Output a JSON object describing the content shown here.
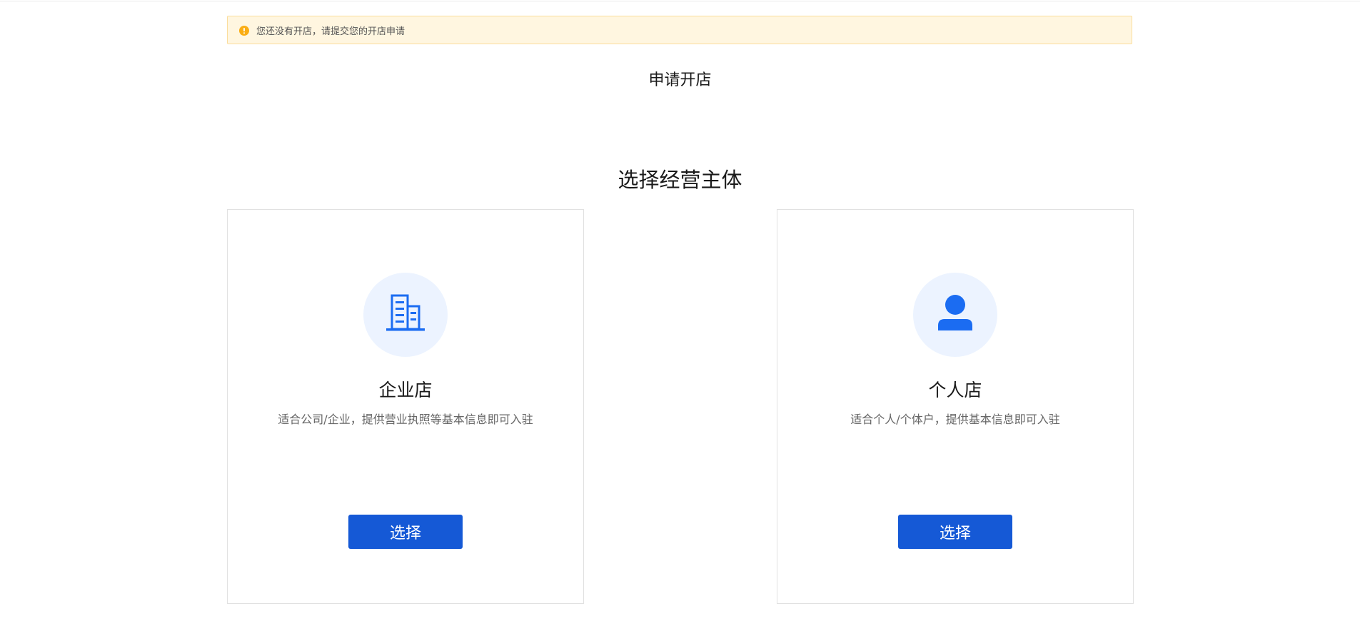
{
  "notice": {
    "icon": "warning-icon",
    "text": "您还没有开店，请提交您的开店申请",
    "icon_color": "#faad14",
    "background": "#fff6e0"
  },
  "page_title": "申请开店",
  "section_title": "选择经营主体",
  "cards": [
    {
      "icon": "building-icon",
      "title": "企业店",
      "description": "适合公司/企业，提供营业执照等基本信息即可入驻",
      "button_label": "选择"
    },
    {
      "icon": "person-icon",
      "title": "个人店",
      "description": "适合个人/个体户，提供基本信息即可入驻",
      "button_label": "选择"
    }
  ],
  "colors": {
    "accent": "#1559d6",
    "icon_blue": "#1b6cf2",
    "icon_circle_bg": "#ecf3ff"
  }
}
